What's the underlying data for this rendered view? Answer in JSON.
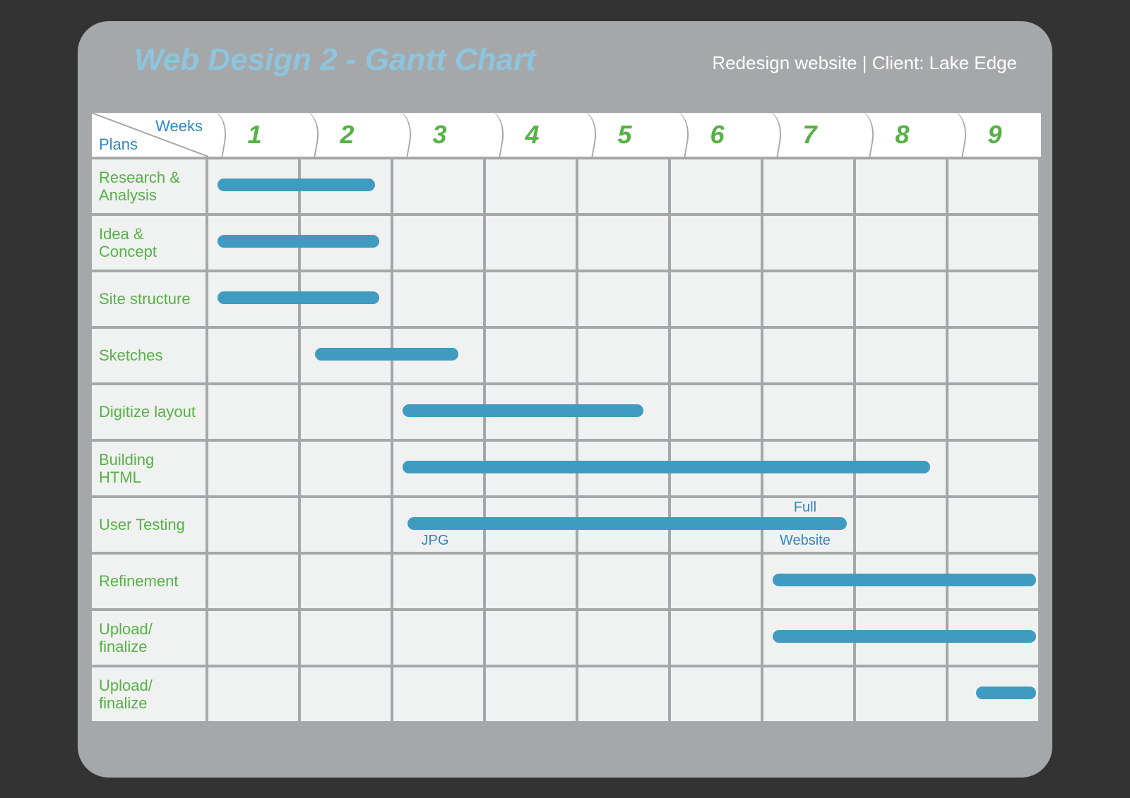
{
  "header": {
    "title": "Web Design 2 - Gantt Chart",
    "subtitle": "Redesign website | Client: Lake Edge"
  },
  "axis": {
    "weeks_label": "Weeks",
    "plans_label": "Plans"
  },
  "chart_data": {
    "type": "bar",
    "orientation": "gantt",
    "x_unit": "week",
    "x_range": [
      0.5,
      9.5
    ],
    "columns": [
      "1",
      "2",
      "3",
      "4",
      "5",
      "6",
      "7",
      "8",
      "9"
    ],
    "tasks": [
      {
        "label": "Research & Analysis",
        "start": 0.6,
        "end": 2.3
      },
      {
        "label": "Idea & Concept",
        "start": 0.6,
        "end": 2.35
      },
      {
        "label": "Site structure",
        "start": 0.6,
        "end": 2.35
      },
      {
        "label": "Sketches",
        "start": 1.65,
        "end": 3.2
      },
      {
        "label": "Digitize layout",
        "start": 2.6,
        "end": 5.2
      },
      {
        "label": "Building HTML",
        "start": 2.6,
        "end": 8.3
      },
      {
        "label": "User Testing",
        "start": 2.65,
        "end": 7.4,
        "annotations": [
          {
            "text": "JPG",
            "x": 2.95,
            "v": "below"
          },
          {
            "text": "Full",
            "x": 6.95,
            "v": "above"
          },
          {
            "text": "Website",
            "x": 6.95,
            "v": "below"
          }
        ]
      },
      {
        "label": "Refinement",
        "start": 6.6,
        "end": 9.45
      },
      {
        "label": "Upload/ finalize",
        "start": 6.6,
        "end": 9.45
      },
      {
        "label": "Upload/ finalize",
        "start": 8.8,
        "end": 9.45
      }
    ]
  }
}
